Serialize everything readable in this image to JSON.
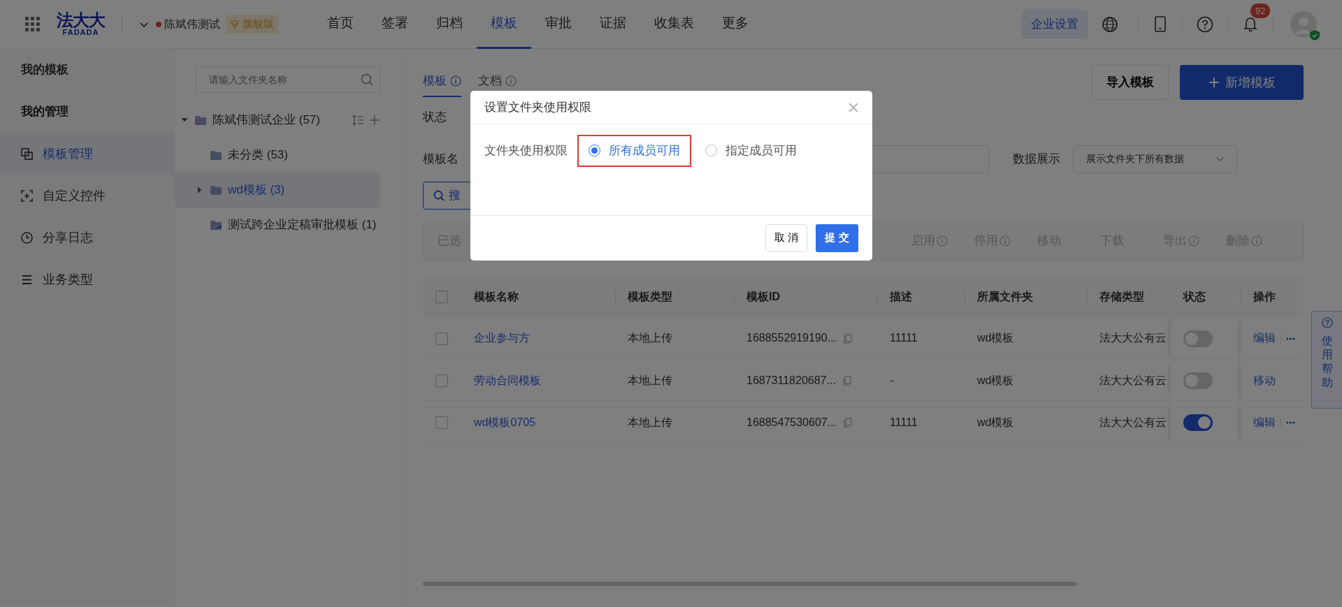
{
  "top_nav": {
    "logo_text": "法大大",
    "logo_subtext": "FADADA",
    "company": "陈斌伟测试",
    "edition": "旗舰版",
    "menu": [
      {
        "label": "首页",
        "selected": false
      },
      {
        "label": "签署",
        "selected": false
      },
      {
        "label": "归档",
        "selected": false
      },
      {
        "label": "模板",
        "selected": true
      },
      {
        "label": "审批",
        "selected": false
      },
      {
        "label": "证据",
        "selected": false
      },
      {
        "label": "收集表",
        "selected": false
      },
      {
        "label": "更多",
        "selected": false
      }
    ],
    "settings_button": "企业设置",
    "notification_count": "92"
  },
  "sidebar": {
    "title": "我的模板",
    "section": "我的管理",
    "items": [
      {
        "label": "模板管理",
        "kind": "copy",
        "selected": true
      },
      {
        "label": "自定义控件",
        "kind": "scan",
        "selected": false
      },
      {
        "label": "分享日志",
        "kind": "clock",
        "selected": false
      },
      {
        "label": "业务类型",
        "kind": "list",
        "selected": false
      }
    ]
  },
  "folder_tree": {
    "placeholder": "请输入文件夹名称",
    "nodes": [
      {
        "label": "陈斌伟测试企业 (57)",
        "expanded": true,
        "selected": false,
        "children": [
          {
            "label": "未分类 (53)",
            "selected": false
          },
          {
            "label": "wd模板 (3)",
            "expanded": false,
            "selected": true
          },
          {
            "label": "测试跨企业定稿审批模板 (1)",
            "kind": "shared",
            "selected": false
          }
        ]
      }
    ]
  },
  "content": {
    "tabs": [
      {
        "label": "模板",
        "selected": true
      },
      {
        "label": "文档",
        "selected": false
      }
    ],
    "import_button": "导入模板",
    "new_button": "新增模板",
    "status_label": "状态",
    "name_label": "模板名",
    "data_display_label": "数据展示",
    "data_display_value": "展示文件夹下所有数据",
    "search_button": "搜",
    "selected_label": "已选",
    "batch_actions": [
      {
        "label": "启用",
        "info": true
      },
      {
        "label": "停用",
        "info": true
      },
      {
        "label": "移动",
        "info": false
      },
      {
        "label": "下载",
        "info": false
      },
      {
        "label": "导出",
        "info": true
      },
      {
        "label": "删除",
        "info": true
      }
    ]
  },
  "table": {
    "select_all_checked": false,
    "columns": [
      "模板名称",
      "模板类型",
      "模板ID",
      "描述",
      "所属文件夹",
      "存储类型",
      "状态",
      "操作"
    ],
    "rows": [
      {
        "name": "企业参与方",
        "type": "本地上传",
        "id": "1688552919190...",
        "description": "11111",
        "folder": "wd模板",
        "storage": "法大大公有云",
        "enabled": false,
        "checked": false,
        "actions": [
          "编辑"
        ],
        "more": true
      },
      {
        "name": "劳动合同模板",
        "type": "本地上传",
        "id": "1687311820687...",
        "description": "-",
        "folder": "wd模板",
        "storage": "法大大公有云",
        "enabled": false,
        "checked": false,
        "actions": [
          "移动"
        ],
        "more": false
      },
      {
        "name": "wd模板0705",
        "type": "本地上传",
        "id": "1688547530607...",
        "description": "11111",
        "folder": "wd模板",
        "storage": "法大大公有云",
        "enabled": true,
        "checked": false,
        "actions": [
          "编辑"
        ],
        "more": true
      }
    ]
  },
  "help_tab": "使用帮助",
  "dialog": {
    "title": "设置文件夹使用权限",
    "field_label": "文件夹使用权限",
    "options": [
      {
        "label": "所有成员可用",
        "selected": true,
        "highlighted": true
      },
      {
        "label": "指定成员可用",
        "selected": false,
        "highlighted": false
      }
    ],
    "cancel_button": "取 消",
    "submit_button": "提 交"
  }
}
